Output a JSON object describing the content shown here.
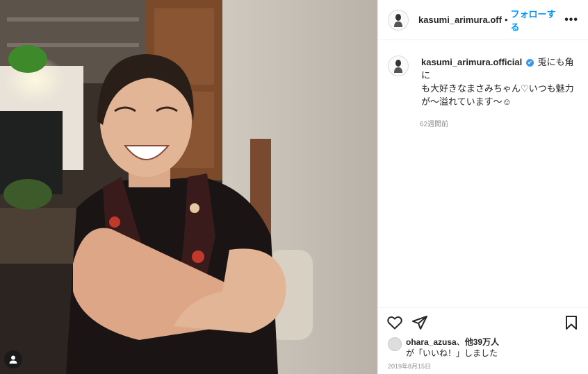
{
  "header": {
    "username": "kasumi_arimura.off",
    "separator": "•",
    "follow_label": "フォローする",
    "more_label": "•••"
  },
  "caption": {
    "username": "kasumi_arimura.official",
    "verified_mark": "✔",
    "text_line1": "兎にも角に",
    "text_line2": "も大好きなまさみちゃん♡いつも魅力",
    "text_line3": "が〜溢れています〜☺",
    "time": "62週間前"
  },
  "likes": {
    "user": "ohara_azusa",
    "joiner": "、",
    "others": "他39万人",
    "suffix": "が「いいね！」しました"
  },
  "date": "2019年8月15日",
  "icons": {
    "like": "heart-icon",
    "share": "send-icon",
    "save": "bookmark-icon",
    "tag": "user-tag-icon"
  },
  "colors": {
    "accent": "#0095f6",
    "verified": "#3897f0",
    "muted": "#8e8e8e"
  }
}
